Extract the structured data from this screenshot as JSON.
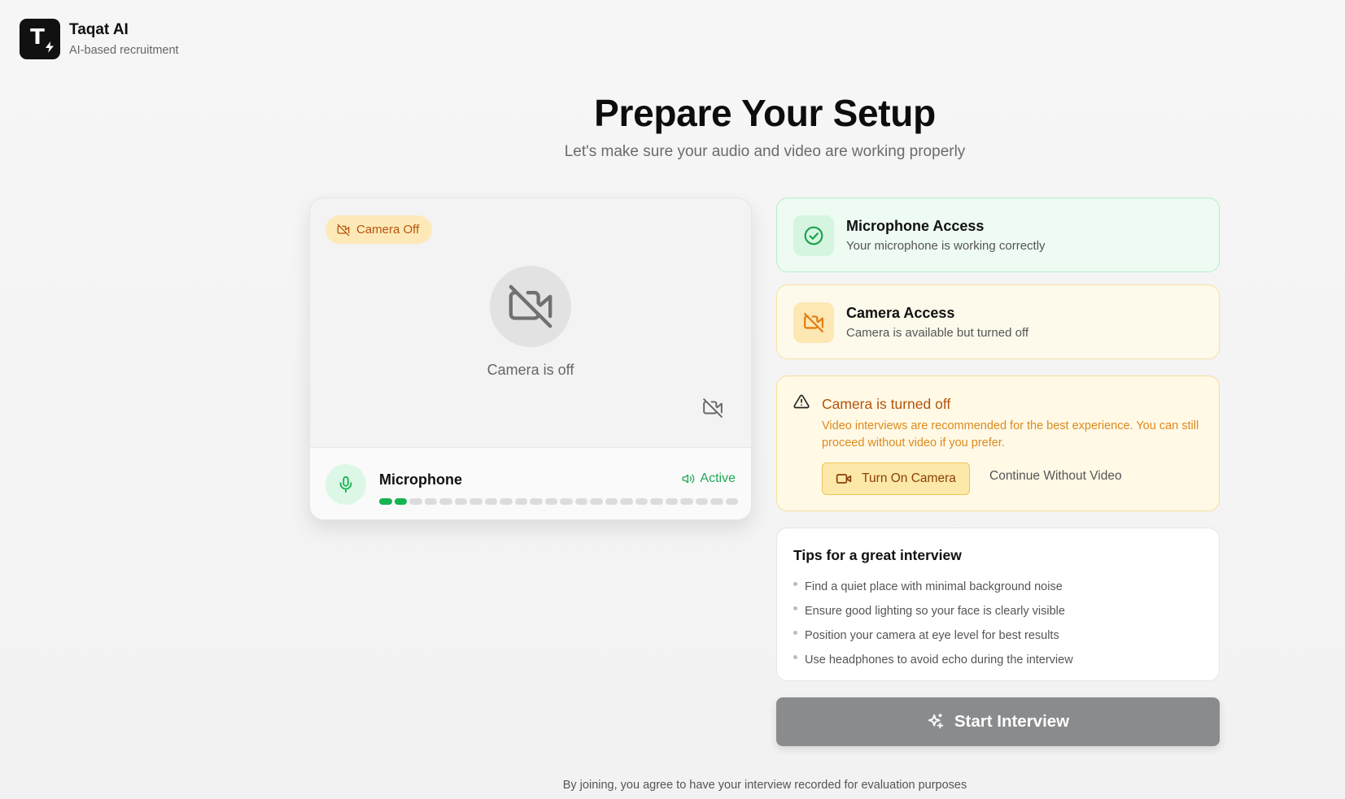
{
  "brand": {
    "name": "Taqat AI",
    "tagline": "AI-based recruitment",
    "logo_letter": "T",
    "logo_icon": "bolt-icon"
  },
  "header": {
    "title": "Prepare Your Setup",
    "subtitle": "Let's make sure your audio and video are working properly"
  },
  "preview": {
    "camera_pill": "Camera Off",
    "camera_off_text": "Camera is off",
    "microphone": {
      "label": "Microphone",
      "status": "Active",
      "level": {
        "active_segments": 2,
        "total_segments": 24
      }
    }
  },
  "status": {
    "microphone": {
      "title": "Microphone Access",
      "description": "Your microphone is working correctly"
    },
    "camera": {
      "title": "Camera Access",
      "description": "Camera is available but turned off"
    }
  },
  "warning": {
    "title": "Camera is turned off",
    "description": "Video interviews are recommended for the best experience. You can still proceed without video if you prefer.",
    "turn_on_label": "Turn On Camera",
    "continue_label": "Continue Without Video"
  },
  "tips": {
    "title": "Tips for a great interview",
    "items": [
      "Find a quiet place with minimal background noise",
      "Ensure good lighting so your face is clearly visible",
      "Position your camera at eye level for best results",
      "Use headphones to avoid echo during the interview"
    ]
  },
  "start_label": "Start Interview",
  "footer_note": "By joining, you agree to have your interview recorded for evaluation purposes",
  "colors": {
    "success": "#16b351",
    "warning": "#b4530a",
    "disabled_button": "#8a8b8d"
  }
}
